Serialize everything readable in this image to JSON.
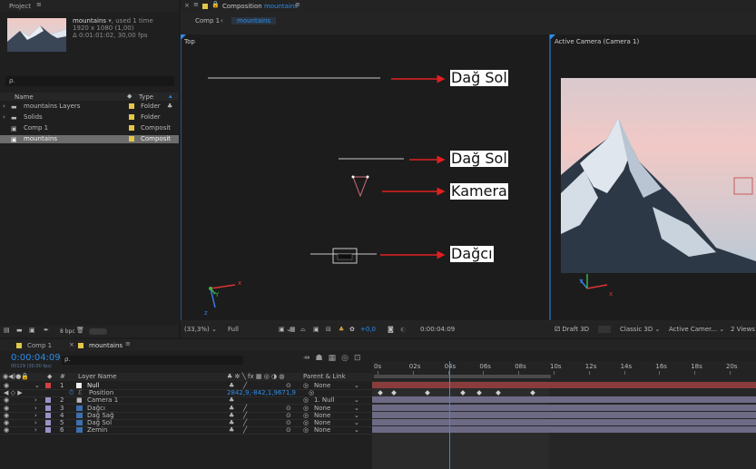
{
  "project": {
    "title": "Project",
    "menu_icon": "hamburger-icon",
    "selected_name": "mountains",
    "used": ", used 1 time",
    "resolution": "1920 x 1080 (1,00)",
    "duration": "Δ 0:01:01:02, 30,00 fps",
    "search_placeholder": "ρ.",
    "col_name": "Name",
    "col_type": "Type",
    "items": [
      {
        "name": "mountains Layers",
        "type": "Folder",
        "icon": "folder-icon",
        "color": "#e3c64a"
      },
      {
        "name": "Solids",
        "type": "Folder",
        "icon": "folder-icon",
        "color": "#e3c64a"
      },
      {
        "name": "Comp 1",
        "type": "Composit",
        "icon": "composition-icon",
        "color": "#e3c64a"
      },
      {
        "name": "mountains",
        "type": "Composit",
        "icon": "composition-icon",
        "color": "#e3c64a"
      }
    ],
    "bpc": "8 bpc"
  },
  "composition": {
    "panel_label": "Composition",
    "comp_name": "mountains",
    "crumb_1": "Comp 1",
    "crumb_2": "mountains",
    "view_top": "Top",
    "view_active": "Active Camera (Camera 1)",
    "annotations": [
      "Dağ Sol",
      "Dağ Sol",
      "Kamera",
      "Dağcı"
    ],
    "zoom": "(33,3%)",
    "resolution": "Full",
    "exposure": "+0,0",
    "timecode": "0:00:04:09",
    "renderer": "Draft 3D",
    "renderer_mode": "Classic 3D",
    "camera": "Active Camer...",
    "views": "2 Views"
  },
  "timeline": {
    "tab_1": "Comp 1",
    "tab_2": "mountains",
    "timecode": "0:00:04:09",
    "frame_info": "00129 (30.00 fps)",
    "search_placeholder": "ρ.",
    "col_layer_name": "Layer Name",
    "col_parent": "Parent & Link",
    "position_label": "Position",
    "position_value": "2842,9,-842,1,9671,9",
    "ticks": [
      "0s",
      "02s",
      "04s",
      "06s",
      "08s",
      "10s",
      "12s",
      "14s",
      "16s",
      "18s",
      "20s"
    ],
    "playhead_seconds": 4.3,
    "layers": [
      {
        "num": "1",
        "name": "Null",
        "parent": "None",
        "color": "#d24141"
      },
      {
        "num": "2",
        "name": "Camera 1",
        "parent": "1. Null",
        "color": "#9a91c9"
      },
      {
        "num": "3",
        "name": "Dağcı",
        "parent": "None",
        "color": "#9a91c9"
      },
      {
        "num": "4",
        "name": "Dağ Sağ",
        "parent": "None",
        "color": "#9a91c9"
      },
      {
        "num": "5",
        "name": "Dağ Sol",
        "parent": "None",
        "color": "#9a91c9"
      },
      {
        "num": "6",
        "name": "Zemin",
        "parent": "None",
        "color": "#9a91c9"
      }
    ]
  },
  "colors": {
    "accent": "#2d8ceb",
    "arrow": "#e02020",
    "null_bar": "#8a3c3c",
    "layer_bar": "#6d6a85"
  }
}
